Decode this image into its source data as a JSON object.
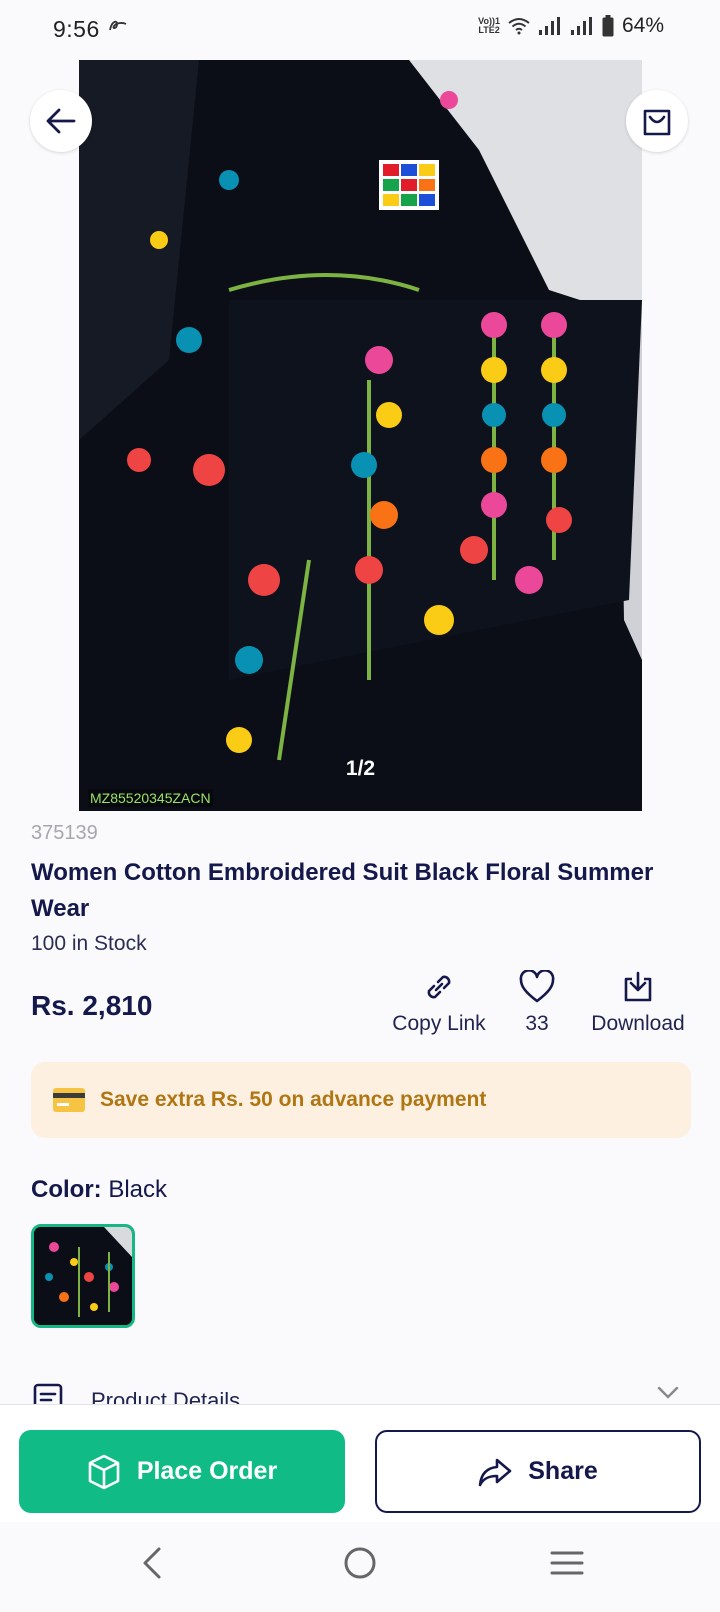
{
  "status_bar": {
    "time": "9:56",
    "network_label_top": "Vo))1",
    "network_label_bottom": "LTE2",
    "battery": "64%"
  },
  "gallery": {
    "counter": "1/2",
    "watermark": "MZ85520345ZACN"
  },
  "product": {
    "sku": "375139",
    "title": "Women Cotton Embroidered Suit Black Floral Summer Wear",
    "stock": "100 in Stock",
    "price": "Rs. 2,810"
  },
  "actions": {
    "copy_link": "Copy Link",
    "likes": "33",
    "download": "Download"
  },
  "promo": {
    "text": "Save extra Rs. 50 on advance payment"
  },
  "color": {
    "label": "Color:",
    "value": "Black"
  },
  "details": {
    "label": "Product Details"
  },
  "buttons": {
    "place_order": "Place Order",
    "share": "Share"
  },
  "colors": {
    "brand_green": "#10bb86",
    "navy": "#14184a",
    "promo_bg": "#fdf0e0",
    "promo_text": "#b07614"
  },
  "icons": [
    "back-arrow-icon",
    "shopping-bag-icon",
    "link-icon",
    "heart-icon",
    "download-icon",
    "credit-card-icon",
    "product-details-icon",
    "chevron-down-icon",
    "box-icon",
    "share-icon",
    "nav-back-icon",
    "nav-home-icon",
    "nav-menu-icon"
  ]
}
